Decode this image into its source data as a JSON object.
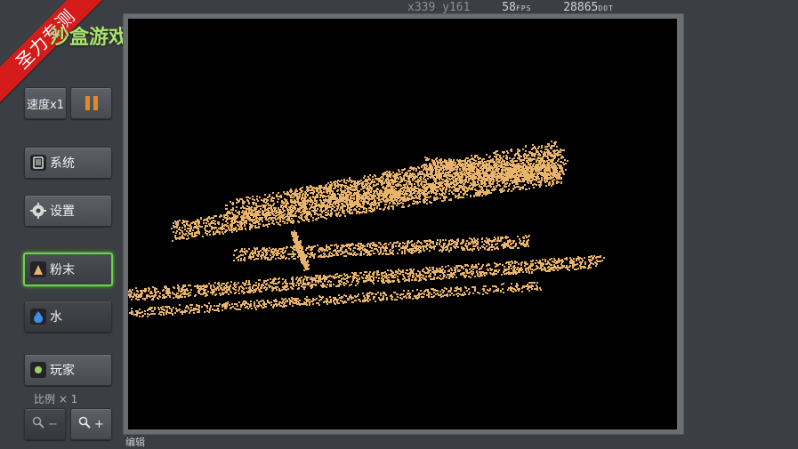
{
  "ribbon": {
    "text": "圣力专测"
  },
  "game": {
    "title": "沙盒游戏"
  },
  "status": {
    "x_label": "x",
    "x_value": "339",
    "y_label": "y",
    "y_value": "161",
    "fps_value": "58",
    "fps_unit": "FPS",
    "dot_value": "28865",
    "dot_unit": "DOT"
  },
  "controls": {
    "speed_label": "速度x1",
    "system_label": "系统",
    "settings_label": "设置",
    "powder_label": "粉末",
    "water_label": "水",
    "player_label": "玩家",
    "scale_label": "比例 × 1",
    "zoom_out_label": "−",
    "zoom_in_label": "+"
  },
  "editor": {
    "label": "编辑"
  },
  "colors": {
    "powder": "#e9b36a",
    "accent_green": "#6fd34a",
    "pause": "#e08a2c"
  }
}
